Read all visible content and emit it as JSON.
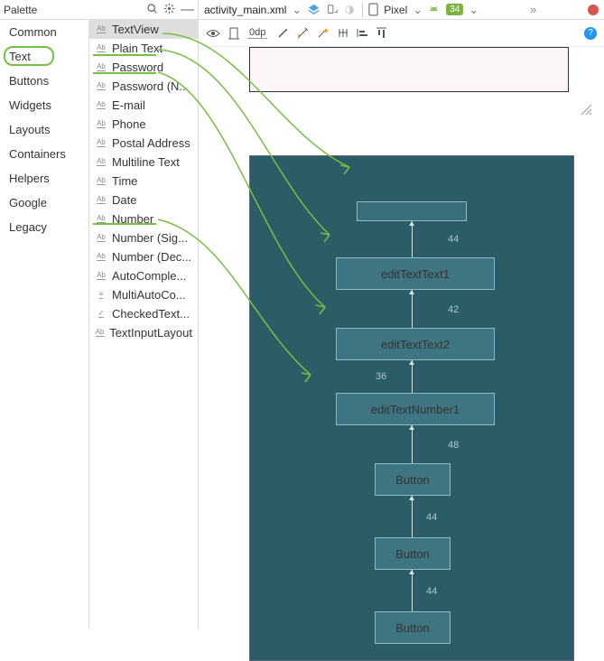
{
  "header": {
    "palette_title": "Palette",
    "tab": "activity_main.xml",
    "device": "Pixel",
    "api": "34",
    "dp": "0dp"
  },
  "categories": [
    "Common",
    "Text",
    "Buttons",
    "Widgets",
    "Layouts",
    "Containers",
    "Helpers",
    "Google",
    "Legacy"
  ],
  "selected_category": "Text",
  "palette": [
    "TextView",
    "Plain Text",
    "Password",
    "Password (N...",
    "E-mail",
    "Phone",
    "Postal Address",
    "Multiline Text",
    "Time",
    "Date",
    "Number",
    "Number (Sig...",
    "Number (Dec...",
    "AutoComple...",
    "MultiAutoCo...",
    "CheckedText...",
    "TextInputLayout"
  ],
  "selected_palette": "TextView",
  "designer": {
    "tv": "",
    "et1": "editTextText1",
    "et2": "editTextText2",
    "et3": "editTextNumber1",
    "btn": "Button",
    "c1": "44",
    "c2": "42",
    "c3": "36",
    "c4": "48",
    "c5": "44",
    "c6": "44"
  }
}
